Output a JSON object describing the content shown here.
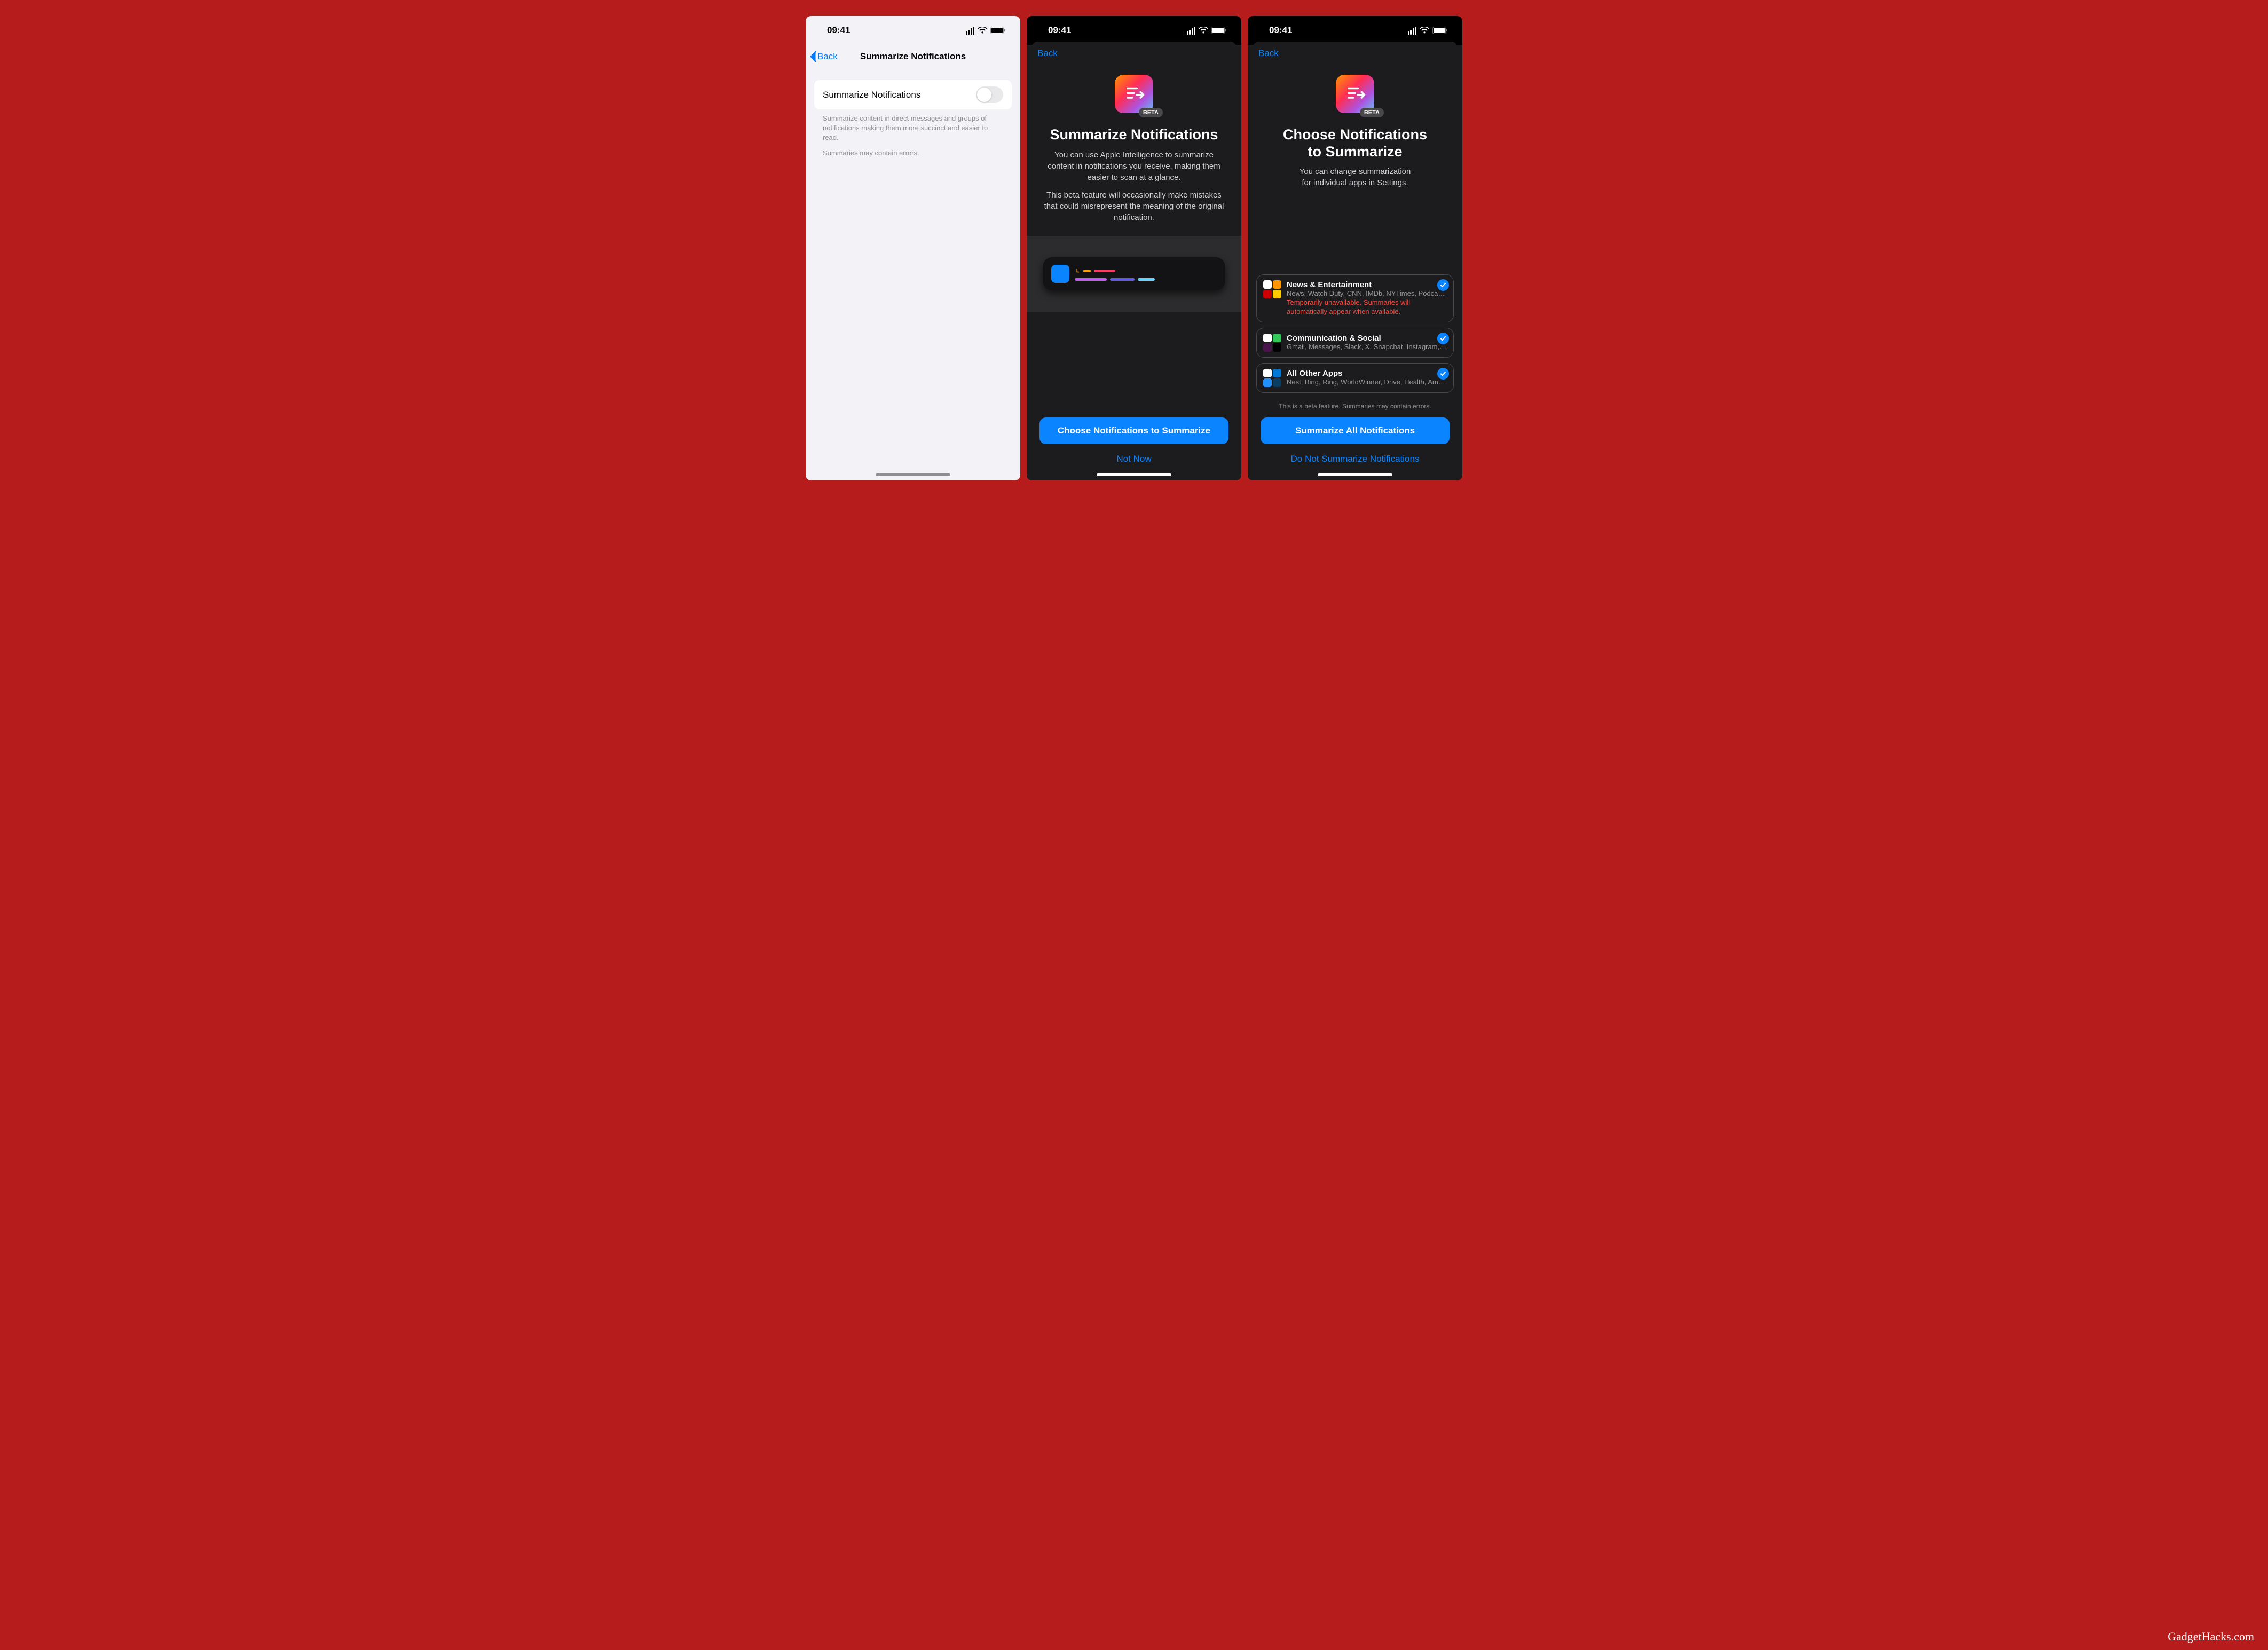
{
  "watermark": "GadgetHacks.com",
  "status_time": "09:41",
  "screen1": {
    "back_label": "Back",
    "title": "Summarize Notifications",
    "row_label": "Summarize Notifications",
    "footer1": "Summarize content in direct messages and groups of notifications making them more succinct and easier to read.",
    "footer2": "Summaries may contain errors."
  },
  "screen2": {
    "back_label": "Back",
    "beta_tag": "BETA",
    "title": "Summarize Notifications",
    "para1": "You can use Apple Intelligence to summarize content in notifications you receive, making them easier to scan at a glance.",
    "para2": "This beta feature will occasionally make mistakes that could misrepresent the meaning of the original notification.",
    "primary": "Choose Notifications to Summarize",
    "secondary": "Not Now"
  },
  "screen3": {
    "back_label": "Back",
    "beta_tag": "BETA",
    "title_line1": "Choose Notifications",
    "title_line2": "to Summarize",
    "subtitle_line1": "You can change summarization",
    "subtitle_line2": "for individual apps in Settings.",
    "categories": [
      {
        "title": "News & Entertainment",
        "subtitle": "News, Watch Duty, CNN, IMDb, NYTimes, Podcasts, R…",
        "warning": "Temporarily unavailable. Summaries will automatically appear when available.",
        "colors": [
          "#ffffff",
          "#ff9500",
          "#cc0000",
          "#ffcc00"
        ]
      },
      {
        "title": "Communication & Social",
        "subtitle": "Gmail, Messages, Slack, X, Snapchat, Instagram, Mes…",
        "colors": [
          "#ffffff",
          "#34c759",
          "#4a154b",
          "#000000"
        ]
      },
      {
        "title": "All Other Apps",
        "subtitle": "Nest, Bing, Ring, WorldWinner, Drive, Health, Amazon…",
        "colors": [
          "#ffffff",
          "#0078d4",
          "#1e90ff",
          "#0a3d62"
        ]
      }
    ],
    "beta_note": "This is a beta feature. Summaries may contain errors.",
    "primary": "Summarize All Notifications",
    "secondary": "Do Not Summarize Notifications"
  }
}
